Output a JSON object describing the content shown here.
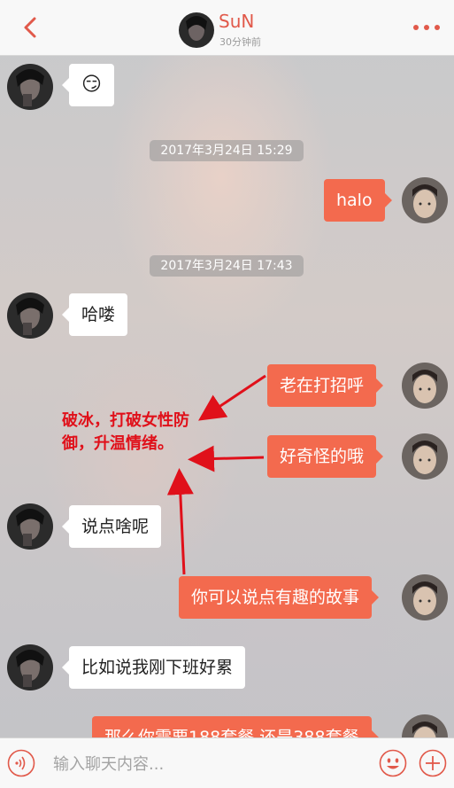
{
  "header": {
    "name": "SuN",
    "status": "30分钟前",
    "back_icon": "chevron-left-icon",
    "more_icon": "more-dots-icon",
    "accent_color": "#e1594a"
  },
  "messages": [
    {
      "side": "left",
      "text": "😏"
    },
    {
      "type": "timestamp",
      "text": "2017年3月24日 15:29"
    },
    {
      "side": "right",
      "text": "halo"
    },
    {
      "type": "timestamp",
      "text": "2017年3月24日 17:43"
    },
    {
      "side": "left",
      "text": "哈喽"
    },
    {
      "side": "right",
      "text": "老在打招呼"
    },
    {
      "side": "right",
      "text": "好奇怪的哦"
    },
    {
      "side": "left",
      "text": "说点啥呢"
    },
    {
      "side": "right",
      "text": "你可以说点有趣的故事"
    },
    {
      "side": "left",
      "text": "比如说我刚下班好累"
    },
    {
      "side": "right",
      "text": "那么你需要188套餐 还是388套餐"
    }
  ],
  "annotation": {
    "text": "破冰，打破女性防御，升温情绪。",
    "color": "#e0101a"
  },
  "bubble_colors": {
    "outgoing": "#f36a4e",
    "incoming": "#ffffff"
  },
  "input": {
    "placeholder": "输入聊天内容...",
    "voice_icon": "voice-icon",
    "emoji_icon": "emoji-icon",
    "plus_icon": "plus-icon"
  }
}
